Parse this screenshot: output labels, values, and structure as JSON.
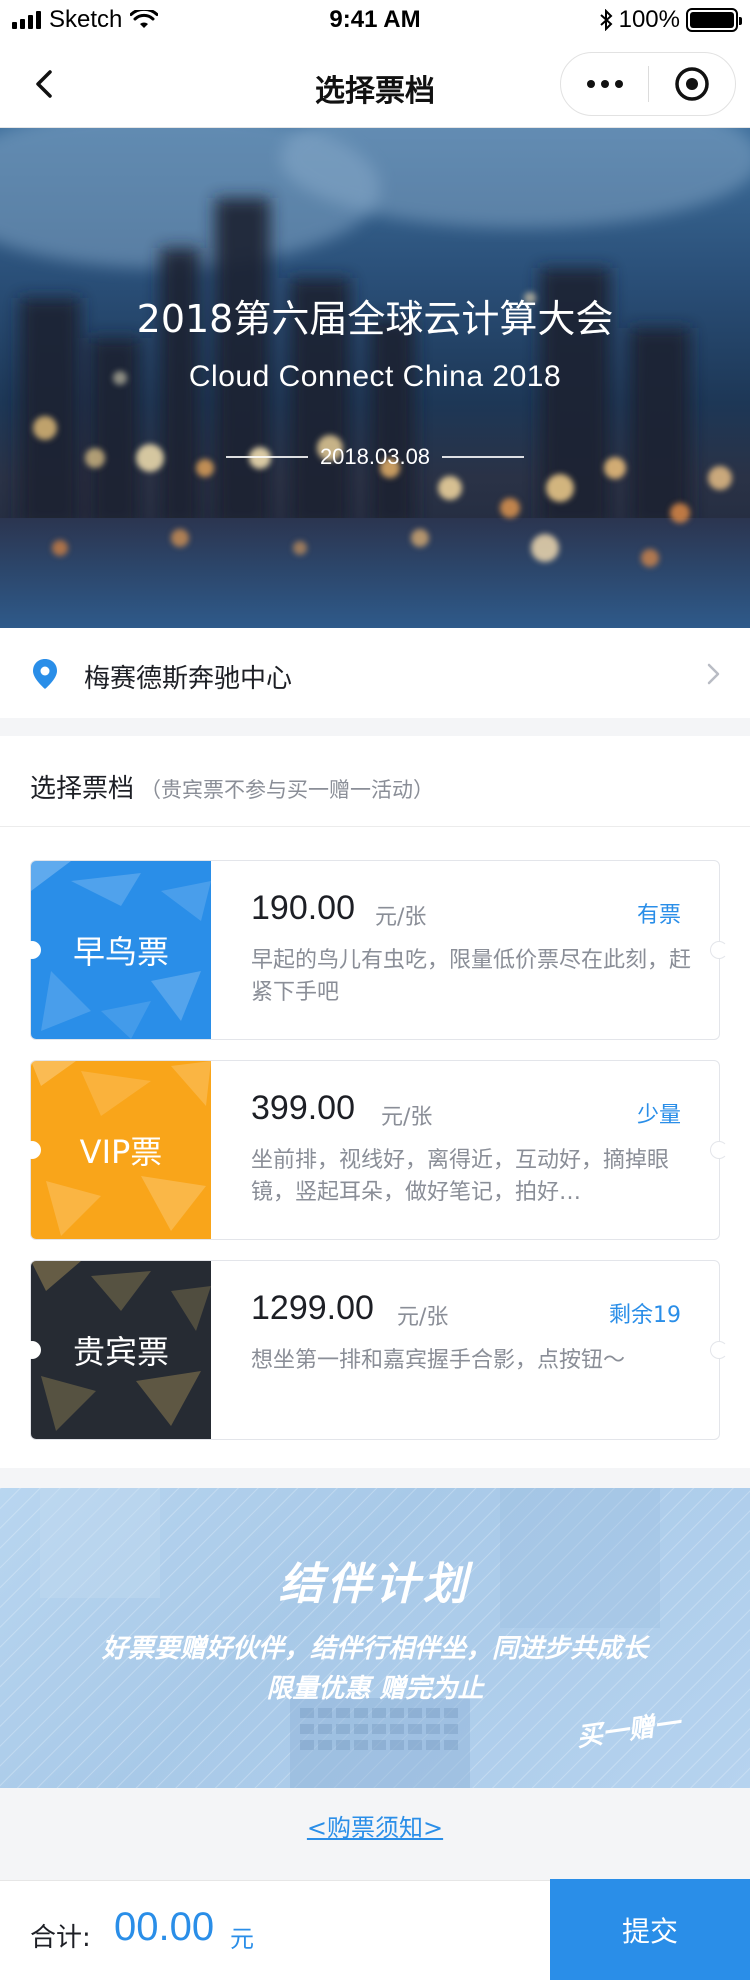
{
  "status_bar": {
    "carrier": "Sketch",
    "time": "9:41 AM",
    "battery": "100%"
  },
  "nav": {
    "title": "选择票档"
  },
  "hero": {
    "title": "2018第六届全球云计算大会",
    "subtitle": "Cloud Connect China 2018",
    "date": "2018.03.08"
  },
  "location": {
    "name": "梅赛德斯奔驰中心"
  },
  "tickets_section": {
    "title": "选择票档",
    "note": "（贵宾票不参与买一赠一活动）",
    "tickets": [
      {
        "name": "早鸟票",
        "price": "190.00",
        "unit": "元/张",
        "status": "有票",
        "desc": "早起的鸟儿有虫吃，限量低价票尽在此刻，赶紧下手吧",
        "color": "#2a8ee8"
      },
      {
        "name": "VIP票",
        "price": "399.00",
        "unit": "元/张",
        "status": "少量",
        "desc": "坐前排，视线好，离得近，互动好，摘掉眼镜，竖起耳朵，做好笔记，拍好…",
        "color": "#f9a51a"
      },
      {
        "name": "贵宾票",
        "price": "1299.00",
        "unit": "元/张",
        "status": "剩余19",
        "desc": "想坐第一排和嘉宾握手合影，点按钮～",
        "color": "#262b33"
      }
    ]
  },
  "banner": {
    "title": "结伴计划",
    "line1": "好票要赠好伙伴，结伴行相伴坐，同进步共成长",
    "line2": "限量优惠 赠完为止",
    "tag": "买一赠一"
  },
  "notice": {
    "label": "<购票须知>"
  },
  "footer": {
    "total_label": "合计:",
    "total_amount": "00.00",
    "total_unit": "元",
    "submit_label": "提交"
  },
  "colors": {
    "accent": "#2a8ee8",
    "vip": "#f9a51a",
    "premium": "#262b33"
  }
}
